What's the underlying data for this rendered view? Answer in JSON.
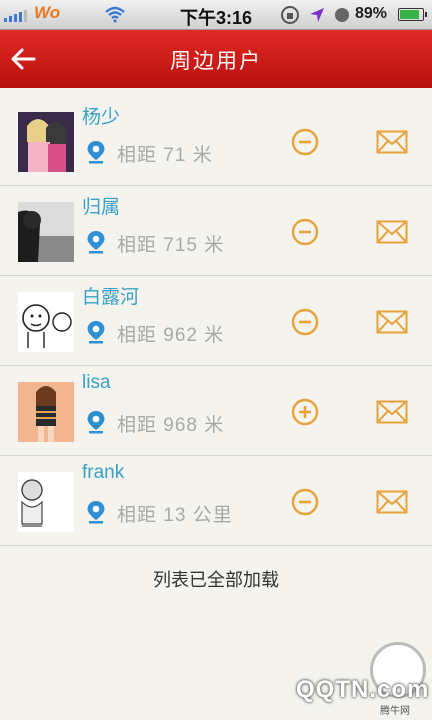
{
  "status_bar": {
    "carrier": "Wo",
    "time": "下午3:16",
    "battery": "89%",
    "battery_level": 0.89
  },
  "header": {
    "title": "周边用户",
    "back_icon": "left-arrow-icon"
  },
  "users": [
    {
      "name": "杨少",
      "distance": "相距 71 米",
      "action": "remove"
    },
    {
      "name": "归属",
      "distance": "相距 715 米",
      "action": "remove"
    },
    {
      "name": "白露河",
      "distance": "相距 962 米",
      "action": "remove"
    },
    {
      "name": "lisa",
      "distance": "相距 968 米",
      "action": "add"
    },
    {
      "name": "frank",
      "distance": "相距 13 公里",
      "action": "remove"
    }
  ],
  "footer": {
    "text": "列表已全部加载"
  },
  "watermark": {
    "text": "QQTN.com",
    "small": "腾牛网"
  },
  "colors": {
    "header": "#cc1a16",
    "name": "#3aa0c8",
    "icon_orange": "#e8a23a",
    "pin_blue": "#2f8fd0"
  }
}
